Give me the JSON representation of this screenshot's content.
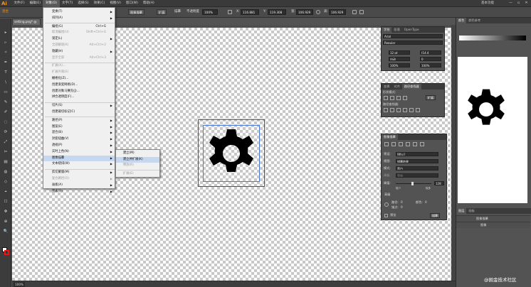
{
  "app": {
    "logo": "Ai",
    "workspace": "基本功能",
    "window_controls": [
      "—",
      "▫",
      "✕"
    ]
  },
  "menubar": {
    "items": [
      "文件(F)",
      "编辑(E)",
      "对象(O)",
      "文字(T)",
      "选择(S)",
      "效果(C)",
      "视图(V)",
      "窗口(W)",
      "帮助(H)"
    ],
    "active_index": 2
  },
  "controlbar": {
    "selection_label": "混合",
    "preset_label": "图像描摹",
    "expand_label": "扩展",
    "mode_label": "描摹",
    "opacity_label": "不透明度",
    "opacity_value": "100%",
    "x_label": "X:",
    "x_value": "116.881",
    "y_label": "Y:",
    "y_value": "119.308",
    "w_label": "宽:",
    "w_value": "106.929",
    "h_label": "高:",
    "h_value": "106.929"
  },
  "document": {
    "tab_title": "setting.png* @",
    "zoom": "100%"
  },
  "object_menu": {
    "items": [
      {
        "label": "变换(T)",
        "arrow": true
      },
      {
        "label": "排列(A)",
        "arrow": true
      },
      {
        "sep": true
      },
      {
        "label": "编组(G)",
        "shortcut": "Ctrl+G"
      },
      {
        "label": "取消编组(U)",
        "shortcut": "Shift+Ctrl+G",
        "disabled": true
      },
      {
        "label": "锁定(L)",
        "arrow": true
      },
      {
        "label": "全部解锁(K)",
        "shortcut": "Alt+Ctrl+2",
        "disabled": true
      },
      {
        "label": "隐藏(H)",
        "arrow": true
      },
      {
        "label": "显示全部",
        "shortcut": "Alt+Ctrl+3",
        "disabled": true
      },
      {
        "sep": true
      },
      {
        "label": "扩展(X)...",
        "disabled": true
      },
      {
        "label": "扩展外观(E)",
        "disabled": true
      },
      {
        "label": "栅格化(Z)..."
      },
      {
        "label": "创建渐变网格(D)..."
      },
      {
        "label": "创建对象马赛克(J)..."
      },
      {
        "label": "拼合透明度(F)..."
      },
      {
        "sep": true
      },
      {
        "label": "切片(S)",
        "arrow": true
      },
      {
        "label": "创建裁切标记(C)"
      },
      {
        "sep": true
      },
      {
        "label": "路径(P)",
        "arrow": true
      },
      {
        "label": "图案(E)",
        "arrow": true
      },
      {
        "label": "混合(B)",
        "arrow": true
      },
      {
        "label": "封套扭曲(V)",
        "arrow": true
      },
      {
        "label": "透视(P)",
        "arrow": true
      },
      {
        "label": "实时上色(N)",
        "arrow": true
      },
      {
        "label": "图像描摹",
        "arrow": true,
        "highlighted": true
      },
      {
        "label": "文本绕排(W)",
        "arrow": true
      },
      {
        "sep": true
      },
      {
        "label": "剪切蒙版(M)",
        "arrow": true
      },
      {
        "label": "复合路径(O)",
        "arrow": true,
        "disabled": true
      },
      {
        "label": "画板(A)",
        "arrow": true
      },
      {
        "label": "图表(R)",
        "arrow": true
      }
    ]
  },
  "trace_submenu": {
    "items": [
      {
        "label": "建立(M)"
      },
      {
        "label": "建立并扩展(K)",
        "highlighted": true
      },
      {
        "label": "释放(R)",
        "disabled": true
      },
      {
        "sep": true
      },
      {
        "label": "扩展(E)",
        "disabled": true
      }
    ]
  },
  "char_panel": {
    "tabs": [
      "字符",
      "段落",
      "OpenType"
    ],
    "font": "Arial",
    "style": "Regular",
    "size": "12 pt",
    "leading": "(14.4",
    "kerning": "自动",
    "tracking": "0",
    "scale_v": "100%",
    "scale_h": "100%"
  },
  "pathfinder_panel": {
    "tabs": [
      "变换",
      "对齐",
      "路径查找器"
    ],
    "shape_modes_label": "形状模式:",
    "pathfinders_label": "路径查找器:",
    "expand_button": "扩展"
  },
  "trace_panel": {
    "title": "图像描摹",
    "preset_label": "预设:",
    "preset_value": "[默认]",
    "view_label": "视图:",
    "view_value": "描摹结果",
    "mode_label": "模式:",
    "mode_value": "黑白",
    "palette_label": "调板:",
    "palette_value": "受限",
    "threshold_label": "阈值:",
    "threshold_value": "128",
    "threshold_low": "较少",
    "threshold_high": "较多",
    "advanced_label": "高级",
    "paths_label": "路径:",
    "paths_value": "0",
    "colors_label": "颜色:",
    "colors_value": "0",
    "anchors_label": "锚点:",
    "anchors_value": "0",
    "preview_label": "预览",
    "trace_button": "描摹"
  },
  "right_col": {
    "tabs": [
      "颜色",
      "颜色参考"
    ],
    "layers_tabs": [
      "图层",
      "画板"
    ],
    "layer_name": "图像描摹",
    "layer_sub": "图像",
    "layer_count": "1 个图层"
  },
  "watermark": "@掘金技术社区",
  "colors": {
    "accent": "#f7941e",
    "selection_blue": "#4a7bd8",
    "menu_highlight": "#c5d8f0"
  }
}
